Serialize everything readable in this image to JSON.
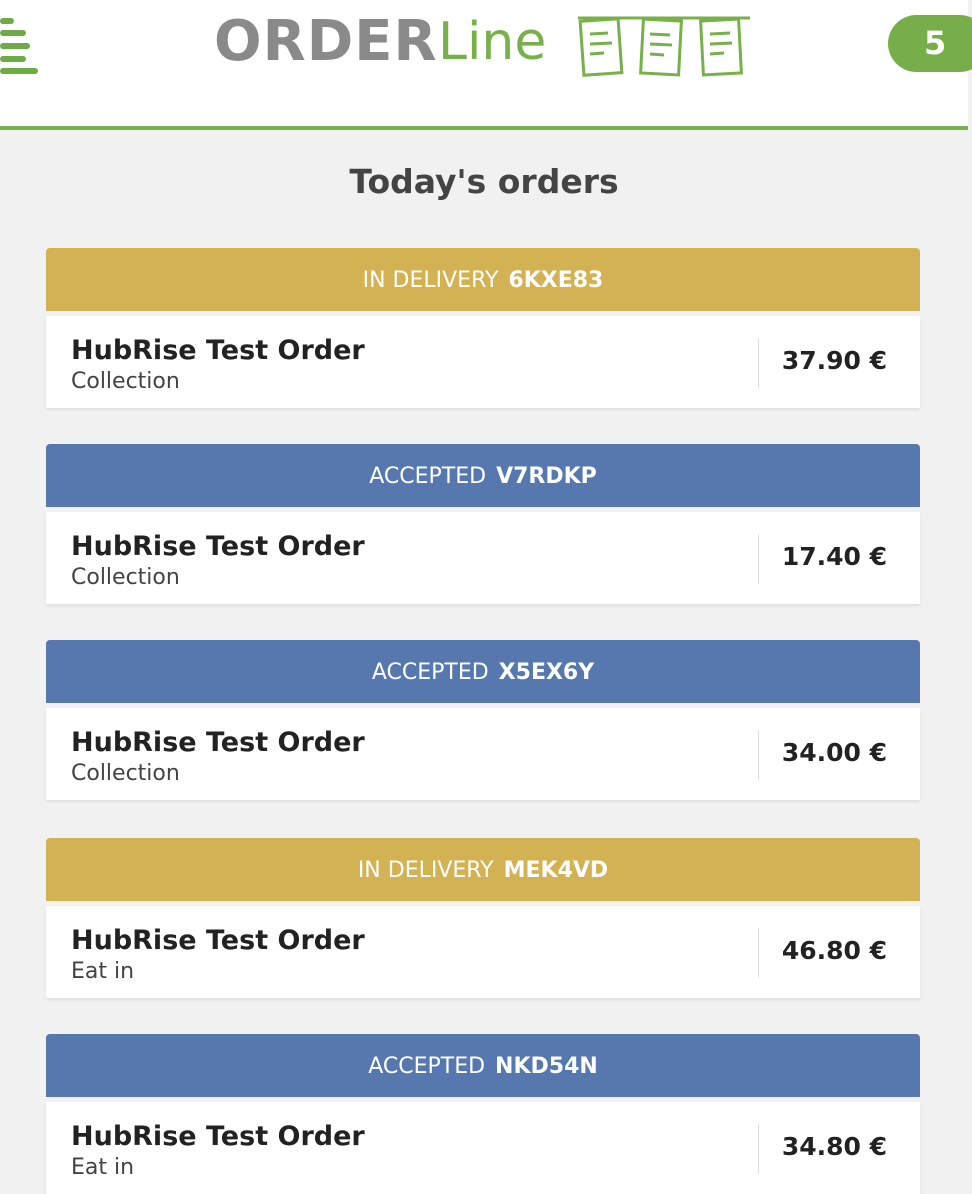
{
  "app": {
    "logo_order": "ORDER",
    "logo_line": "Line",
    "order_count": "5",
    "brand_green": "#78b04b"
  },
  "page": {
    "title": "Today's orders"
  },
  "status_colors": {
    "in_delivery": "#d2b253",
    "accepted": "#5778af"
  },
  "orders": [
    {
      "status": "IN DELIVERY",
      "status_key": "in_delivery",
      "code": "6KXE83",
      "name": "HubRise Test Order",
      "type": "Collection",
      "price": "37.90 €"
    },
    {
      "status": "ACCEPTED",
      "status_key": "accepted",
      "code": "V7RDKP",
      "name": "HubRise Test Order",
      "type": "Collection",
      "price": "17.40 €"
    },
    {
      "status": "ACCEPTED",
      "status_key": "accepted",
      "code": "X5EX6Y",
      "name": "HubRise Test Order",
      "type": "Collection",
      "price": "34.00 €"
    },
    {
      "status": "IN DELIVERY",
      "status_key": "in_delivery",
      "code": "MEK4VD",
      "name": "HubRise Test Order",
      "type": "Eat in",
      "price": "46.80 €"
    },
    {
      "status": "ACCEPTED",
      "status_key": "accepted",
      "code": "NKD54N",
      "name": "HubRise Test Order",
      "type": "Eat in",
      "price": "34.80 €"
    }
  ]
}
